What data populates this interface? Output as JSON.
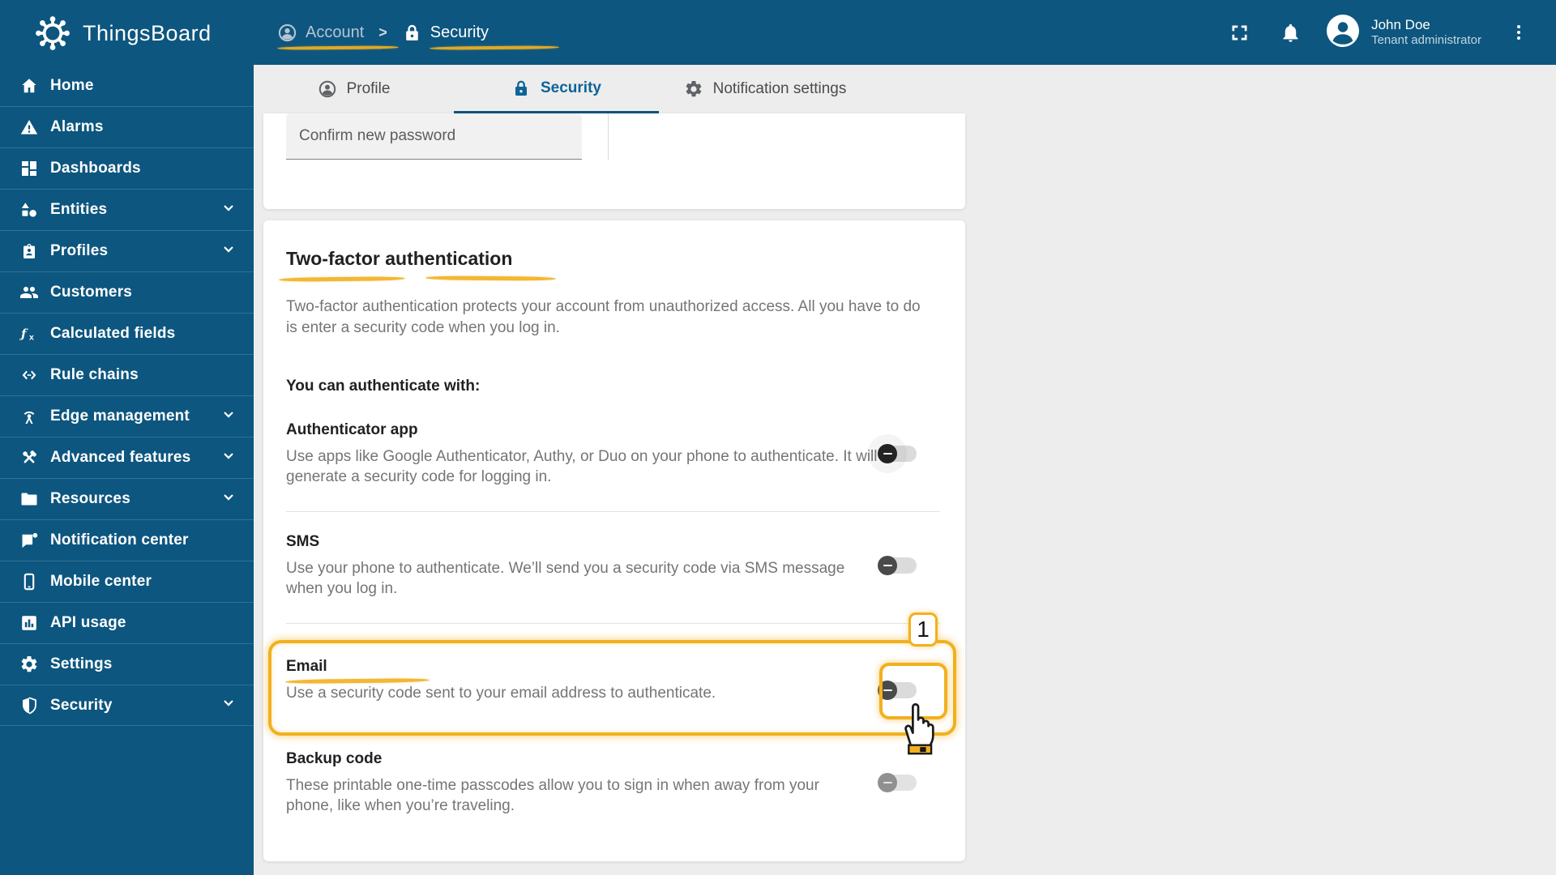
{
  "brand": {
    "name": "ThingsBoard"
  },
  "header": {
    "breadcrumb": {
      "account": "Account",
      "separator": ">",
      "current": "Security"
    },
    "user": {
      "name": "John Doe",
      "role": "Tenant administrator"
    }
  },
  "sidebar": {
    "items": [
      {
        "label": "Home",
        "icon": "home-icon",
        "expandable": false
      },
      {
        "label": "Alarms",
        "icon": "warning-icon",
        "expandable": false
      },
      {
        "label": "Dashboards",
        "icon": "dashboards-icon",
        "expandable": false
      },
      {
        "label": "Entities",
        "icon": "entities-icon",
        "expandable": true
      },
      {
        "label": "Profiles",
        "icon": "profiles-icon",
        "expandable": true
      },
      {
        "label": "Customers",
        "icon": "customers-icon",
        "expandable": false
      },
      {
        "label": "Calculated fields",
        "icon": "function-icon",
        "expandable": false
      },
      {
        "label": "Rule chains",
        "icon": "rule-chains-icon",
        "expandable": false
      },
      {
        "label": "Edge management",
        "icon": "antenna-icon",
        "expandable": true
      },
      {
        "label": "Advanced features",
        "icon": "tools-icon",
        "expandable": true
      },
      {
        "label": "Resources",
        "icon": "folder-icon",
        "expandable": true
      },
      {
        "label": "Notification center",
        "icon": "notification-icon",
        "expandable": false
      },
      {
        "label": "Mobile center",
        "icon": "mobile-icon",
        "expandable": false
      },
      {
        "label": "API usage",
        "icon": "api-usage-icon",
        "expandable": false
      },
      {
        "label": "Settings",
        "icon": "settings-icon",
        "expandable": false
      },
      {
        "label": "Security",
        "icon": "security-icon",
        "expandable": true
      }
    ]
  },
  "tabs": {
    "profile": "Profile",
    "security": "Security",
    "notification": "Notification settings",
    "active": "Security"
  },
  "password_form": {
    "confirm_new_password_label": "Confirm new password"
  },
  "twofa": {
    "title": "Two-factor authentication",
    "intro": "Two-factor authentication protects your account from unauthorized access. All you have to do is enter a security code when you log in.",
    "subheading": "You can authenticate with:",
    "providers": [
      {
        "name": "Authenticator app",
        "description": "Use apps like Google Authenticator, Authy, or Duo on your phone to authenticate. It will generate a security code for logging in.",
        "enabled": false
      },
      {
        "name": "SMS",
        "description": "Use your phone to authenticate. We’ll send you a security code via SMS message when you log in.",
        "enabled": false
      },
      {
        "name": "Email",
        "description": "Use a security code sent to your email address to authenticate.",
        "enabled": false,
        "highlighted": true
      },
      {
        "name": "Backup code",
        "description": "These printable one-time passcodes allow you to sign in when away from your phone, like when you’re traveling.",
        "enabled": false
      }
    ]
  },
  "annotations": {
    "step_badge": "1"
  },
  "colors": {
    "primary": "#0d567f",
    "highlight_yellow": "#f2b01e",
    "active_tab": "#0e6399",
    "page_background": "#ededed",
    "card_background": "#ffffff",
    "muted_text": "#757575"
  }
}
